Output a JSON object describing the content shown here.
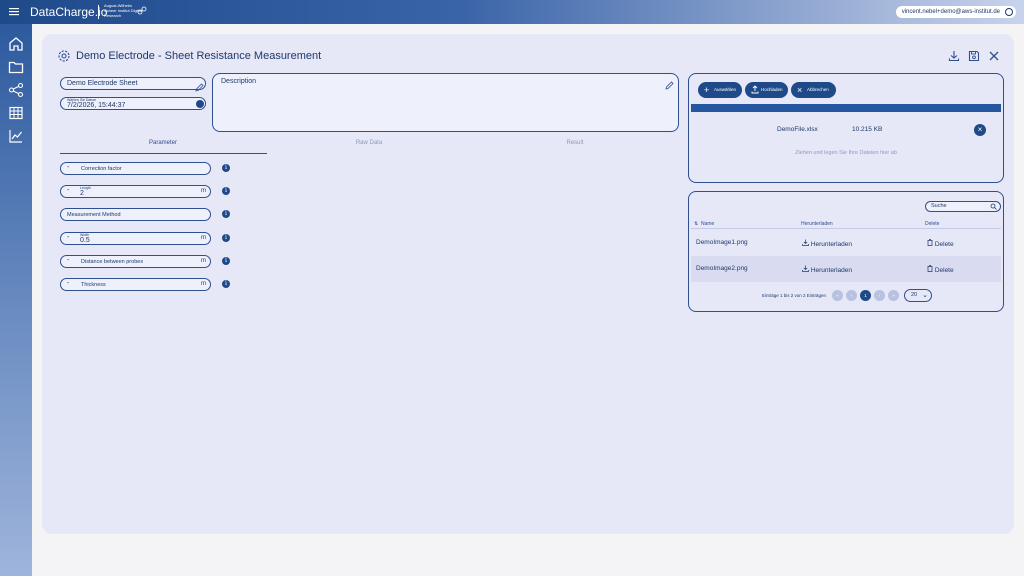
{
  "app": {
    "brand": "DataCharge.io",
    "institute": "August-Wilhelm Scheer Institut Digital Research",
    "user_email": "vincent.nebel+demo@aws-institut.de"
  },
  "page": {
    "title": "Demo Electrode - Sheet Resistance Measurement"
  },
  "form": {
    "name": "Demo Electrode Sheet",
    "date_label": "Wählen Sie Datum",
    "date_value": "7/2/2026, 15:44:37",
    "description_label": "Description"
  },
  "tabs": [
    {
      "label": "Parameter",
      "active": true
    },
    {
      "label": "Raw Data",
      "active": false
    },
    {
      "label": "Result",
      "active": false
    }
  ],
  "params": [
    {
      "prefix": "-",
      "label": "Correction factor",
      "value": "",
      "unit": ""
    },
    {
      "prefix": "-",
      "label": "Length",
      "value": "2",
      "unit": "m"
    },
    {
      "prefix": "",
      "label": "Measurement Method",
      "value": "",
      "unit": ""
    },
    {
      "prefix": "-",
      "label": "Width",
      "value": "0.5",
      "unit": "m"
    },
    {
      "prefix": "-",
      "label": "Distance between probes",
      "value": "",
      "unit": "m"
    },
    {
      "prefix": "-",
      "label": "Thickness",
      "value": "",
      "unit": "m"
    }
  ],
  "upload": {
    "btn_select": "Auswählen",
    "btn_upload": "Hochladen",
    "btn_cancel": "Abbrechen",
    "file_name": "DemoFile.xlsx",
    "file_size": "10.215 KB",
    "drop_hint": "Ziehen und legen Sie Ihre Dateien hier ab"
  },
  "files_table": {
    "search_placeholder": "Suche",
    "headers": [
      "Name",
      "Herunterladen",
      "Delete"
    ],
    "rows": [
      {
        "name": "DemoImage1.png",
        "download": "Herunterladen",
        "delete": "Delete"
      },
      {
        "name": "DemoImage2.png",
        "download": "Herunterladen",
        "delete": "Delete"
      }
    ],
    "pager_info": "Einträge 1 bis 2 von 2 Einträgen",
    "pages": [
      "«",
      "‹",
      "1",
      "›",
      "»"
    ],
    "page_size": "20"
  },
  "colors": {
    "primary": "#1e4a8a",
    "panel": "#e6e7f7",
    "border": "#2f4f8f"
  }
}
